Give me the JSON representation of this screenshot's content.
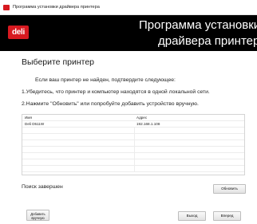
{
  "window": {
    "title": "Программа установки драйвера принтера"
  },
  "banner": {
    "logo_text": "deli",
    "title_line1": "Программа установки",
    "title_line2": "драйвера принтера"
  },
  "main": {
    "heading": "Выберите принтер",
    "instructions": [
      "Если ваш принтер не найден, подтвердите следующее:",
      "1.Убедитесь, что принтер и компьютер находятся в одной локальной сети.",
      "2.Нажмите \"Обновить\" или попробуйте добавить устройство вручную."
    ]
  },
  "table": {
    "columns": [
      "Имя",
      "Адрес"
    ],
    "rows": [
      [
        "Deli D511W",
        "192.168.1.108"
      ]
    ]
  },
  "status": {
    "text": "Поиск завершен"
  },
  "buttons": {
    "refresh": "Обновить",
    "add_manually": "Добавить вручную",
    "exit": "Выход",
    "next": "Вперед"
  },
  "colors": {
    "brand_red": "#d71920",
    "banner_bg": "#000000"
  }
}
